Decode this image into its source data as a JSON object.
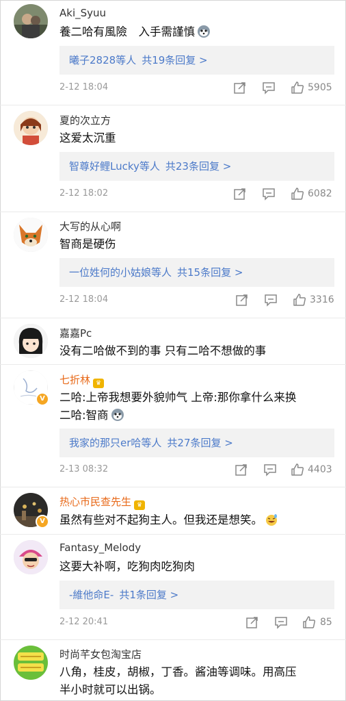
{
  "comments": [
    {
      "username": "Aki_Syuu",
      "lines": [
        "養二哈有風險　入手需謹慎"
      ],
      "replies": {
        "who": "曦子2828等人",
        "count": "共19条回复 >"
      },
      "date": "2-12 18:04",
      "likes": "5905"
    },
    {
      "username": "夏的次立方",
      "lines": [
        "这爱太沉重"
      ],
      "replies": {
        "who": "智尊好鲤Lucky等人",
        "count": "共23条回复 >"
      },
      "date": "2-12 18:02",
      "likes": "6082"
    },
    {
      "username": "大写的从心啊",
      "lines": [
        "智商是硬伤"
      ],
      "replies": {
        "who": "一位姓何的小姑娘等人",
        "count": "共15条回复 >"
      },
      "date": "2-12 18:04",
      "likes": "3316"
    },
    {
      "username": "嘉嘉Pc",
      "lines": [
        "没有二哈做不到的事 只有二哈不想做的事"
      ]
    },
    {
      "username": "七折林",
      "lines": [
        "二哈:上帝我想要外貌帅气 上帝:那你拿什么来换",
        "二哈:智商"
      ],
      "replies": {
        "who": "我家的那只er哈等人",
        "count": "共27条回复 >"
      },
      "date": "2-13 08:32",
      "likes": "4403"
    },
    {
      "username": "热心市民查先生",
      "lines": [
        "虽然有些对不起狗主人。但我还是想笑。"
      ]
    },
    {
      "username": "Fantasy_Melody",
      "lines": [
        "这要大补啊，吃狗肉吃狗肉"
      ],
      "replies": {
        "who": "-維他命E-",
        "count": "共1条回复 >"
      },
      "date": "2-12 20:41",
      "likes": "85"
    },
    {
      "username": "时尚芊女包淘宝店",
      "lines": [
        "八角，桂皮，胡椒，丁香。酱油等调味。用高压",
        "半小时就可以出锅。"
      ]
    }
  ],
  "colors": {
    "reply_link": "#4c7ac9",
    "vip_name": "#e86a1a",
    "meta_gray": "#999999",
    "reply_bg": "#f2f2f2"
  },
  "icons": [
    "share-icon",
    "comment-icon",
    "like-icon",
    "husky-emoji",
    "laugh-sweat-emoji"
  ]
}
